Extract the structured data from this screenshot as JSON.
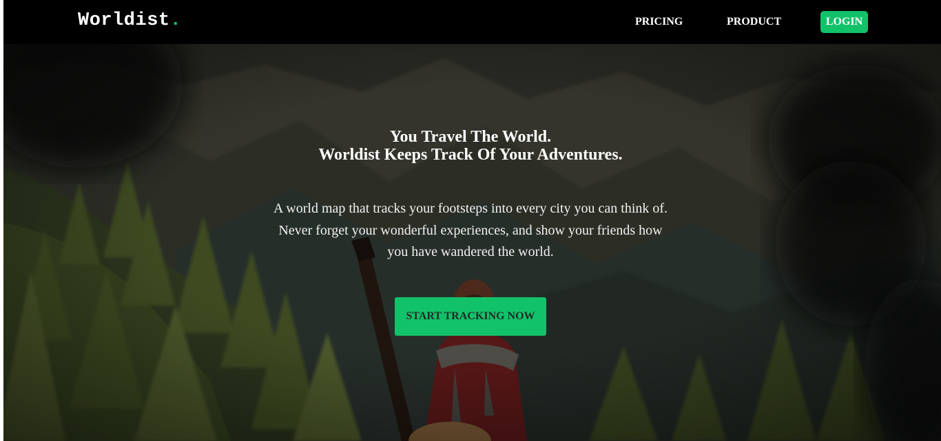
{
  "header": {
    "logo_text": "Worldist",
    "logo_dot": ".",
    "nav": {
      "pricing": "PRICING",
      "product": "PRODUCT",
      "login": "LOGIN"
    }
  },
  "hero": {
    "title_line1": "You Travel The World.",
    "title_line2": "Worldist Keeps Track Of Your Adventures.",
    "description": "A world map that tracks your footsteps into every city you can think of. Never forget your wonderful experiences, and show your friends how you have wandered the world.",
    "cta_label": "START TRACKING NOW"
  },
  "colors": {
    "accent": "#12c26a",
    "header_bg": "#000000",
    "text_light": "#ffffff"
  }
}
